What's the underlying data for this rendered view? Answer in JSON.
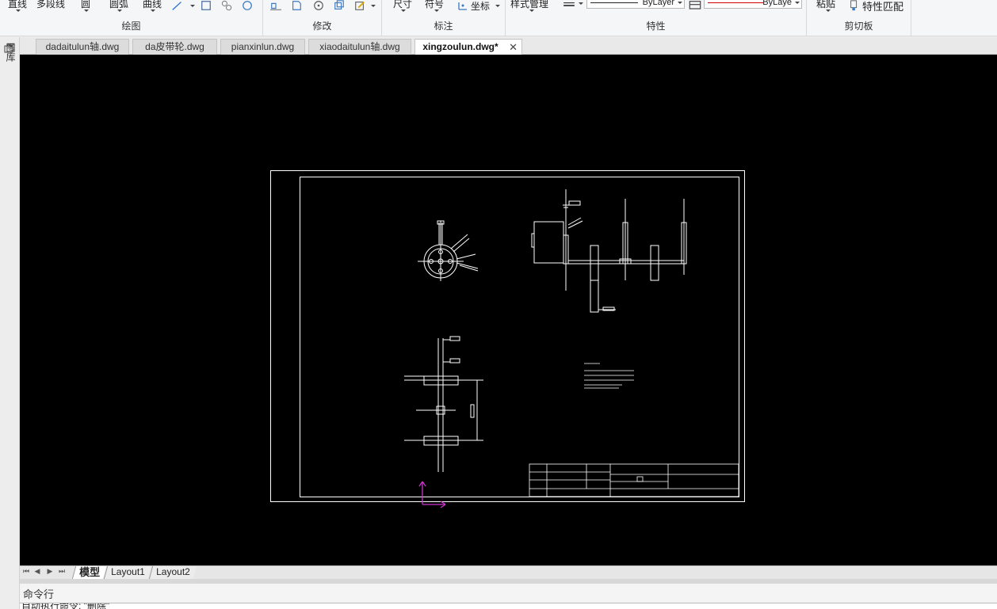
{
  "ribbon": {
    "draw_group": {
      "label": "绘图",
      "tools": [
        "直线",
        "多段线",
        "圆",
        "圆弧",
        "曲线"
      ]
    },
    "modify_group": {
      "label": "修改"
    },
    "annotate_group": {
      "label": "标注",
      "tools": [
        "尺寸",
        "符号",
        "坐标"
      ]
    },
    "properties_group": {
      "label": "特性",
      "style_manager": "样式管理",
      "linetype": "ByLayer",
      "color": "ByLaye"
    },
    "clipboard_group": {
      "label": "剪切板",
      "paste": "粘贴",
      "match_properties": "特性匹配"
    }
  },
  "side_panel": {
    "label": "图库"
  },
  "doc_tabs": [
    {
      "label": "dadaitulun轴.dwg"
    },
    {
      "label": "da皮带轮.dwg"
    },
    {
      "label": "pianxinlun.dwg"
    },
    {
      "label": "xiaodaitulun轴.dwg"
    },
    {
      "label": "xingzoulun.dwg*",
      "active": true
    }
  ],
  "layout_tabs": [
    {
      "label": "模型",
      "active": true
    },
    {
      "label": "Layout1"
    },
    {
      "label": "Layout2"
    }
  ],
  "command": {
    "title": "命令行",
    "history": "自动执行命令: \"删除\""
  },
  "colors": {
    "canvas_bg": "#000000",
    "drawing_lines": "#ffffff",
    "ucs_icon": "#cc33cc",
    "color_line": "#cc0000"
  }
}
